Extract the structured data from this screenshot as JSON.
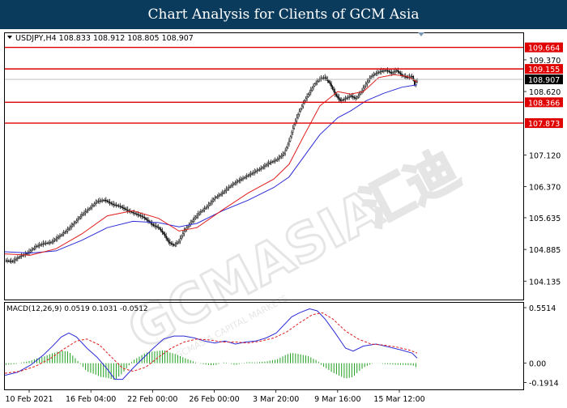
{
  "header": {
    "title": "Chart Analysis for Clients of GCM Asia"
  },
  "watermark": {
    "brand": "GCMASIA",
    "brand_cn": "汇迪",
    "tagline": "GCMASIA CAPITAL MARKETS"
  },
  "chart_data": [
    {
      "type": "candlestick",
      "symbol_line": "USDJPY,H4  108.833 108.912 108.805 108.907",
      "ylim": [
        103.7,
        110.0
      ],
      "y_ticks": [
        "109.370",
        "108.620",
        "107.120",
        "106.370",
        "105.635",
        "104.885",
        "104.135"
      ],
      "x_ticks": [
        "10 Feb 2021",
        "16 Feb 04:00",
        "22 Feb 00:00",
        "26 Feb 00:00",
        "3 Mar 20:00",
        "9 Mar 16:00",
        "15 Mar 12:00"
      ],
      "current_price": "108.907",
      "levels": [
        {
          "label": "109.664",
          "value": 109.664
        },
        {
          "label": "109.155",
          "value": 109.155
        },
        {
          "label": "108.366",
          "value": 108.366
        },
        {
          "label": "107.873",
          "value": 107.873
        }
      ],
      "close_path": [
        [
          0,
          104.62
        ],
        [
          6,
          104.6
        ],
        [
          12,
          104.72
        ],
        [
          18,
          104.8
        ],
        [
          24,
          104.95
        ],
        [
          30,
          105.02
        ],
        [
          36,
          105.05
        ],
        [
          42,
          105.18
        ],
        [
          48,
          105.32
        ],
        [
          54,
          105.5
        ],
        [
          60,
          105.7
        ],
        [
          66,
          105.85
        ],
        [
          72,
          106.02
        ],
        [
          78,
          106.05
        ],
        [
          84,
          105.95
        ],
        [
          90,
          105.9
        ],
        [
          96,
          105.8
        ],
        [
          100,
          105.75
        ],
        [
          104,
          105.7
        ],
        [
          108,
          105.65
        ],
        [
          112,
          105.55
        ],
        [
          116,
          105.45
        ],
        [
          120,
          105.4
        ],
        [
          124,
          105.25
        ],
        [
          128,
          105.05
        ],
        [
          132,
          104.98
        ],
        [
          136,
          105.08
        ],
        [
          140,
          105.32
        ],
        [
          146,
          105.55
        ],
        [
          152,
          105.75
        ],
        [
          158,
          105.9
        ],
        [
          164,
          106.1
        ],
        [
          170,
          106.22
        ],
        [
          176,
          106.38
        ],
        [
          182,
          106.5
        ],
        [
          188,
          106.6
        ],
        [
          194,
          106.7
        ],
        [
          200,
          106.8
        ],
        [
          206,
          106.92
        ],
        [
          212,
          107.0
        ],
        [
          218,
          107.15
        ],
        [
          222,
          107.45
        ],
        [
          226,
          107.85
        ],
        [
          230,
          108.15
        ],
        [
          234,
          108.4
        ],
        [
          238,
          108.6
        ],
        [
          242,
          108.8
        ],
        [
          246,
          108.92
        ],
        [
          250,
          108.95
        ],
        [
          254,
          108.8
        ],
        [
          258,
          108.55
        ],
        [
          262,
          108.4
        ],
        [
          266,
          108.45
        ],
        [
          270,
          108.52
        ],
        [
          274,
          108.45
        ],
        [
          278,
          108.6
        ],
        [
          282,
          108.8
        ],
        [
          286,
          108.98
        ],
        [
          290,
          109.05
        ],
        [
          294,
          109.1
        ],
        [
          298,
          109.12
        ],
        [
          302,
          109.05
        ],
        [
          306,
          109.12
        ],
        [
          310,
          109.0
        ],
        [
          314,
          108.95
        ],
        [
          318,
          108.98
        ],
        [
          320,
          108.78
        ],
        [
          322,
          108.9
        ]
      ],
      "fast_ma_path": [
        [
          0,
          104.78
        ],
        [
          20,
          104.75
        ],
        [
          40,
          104.9
        ],
        [
          60,
          105.25
        ],
        [
          80,
          105.68
        ],
        [
          100,
          105.8
        ],
        [
          120,
          105.62
        ],
        [
          136,
          105.32
        ],
        [
          150,
          105.4
        ],
        [
          170,
          105.82
        ],
        [
          190,
          106.22
        ],
        [
          210,
          106.55
        ],
        [
          222,
          106.9
        ],
        [
          234,
          107.6
        ],
        [
          246,
          108.28
        ],
        [
          260,
          108.62
        ],
        [
          270,
          108.56
        ],
        [
          280,
          108.62
        ],
        [
          292,
          108.95
        ],
        [
          304,
          109.02
        ],
        [
          314,
          108.98
        ],
        [
          322,
          108.85
        ]
      ],
      "slow_ma_path": [
        [
          0,
          104.83
        ],
        [
          20,
          104.8
        ],
        [
          40,
          104.85
        ],
        [
          60,
          105.1
        ],
        [
          80,
          105.4
        ],
        [
          100,
          105.55
        ],
        [
          120,
          105.52
        ],
        [
          136,
          105.42
        ],
        [
          150,
          105.5
        ],
        [
          170,
          105.8
        ],
        [
          190,
          106.05
        ],
        [
          210,
          106.35
        ],
        [
          222,
          106.6
        ],
        [
          234,
          107.1
        ],
        [
          246,
          107.6
        ],
        [
          260,
          108.0
        ],
        [
          270,
          108.16
        ],
        [
          282,
          108.4
        ],
        [
          296,
          108.58
        ],
        [
          310,
          108.72
        ],
        [
          322,
          108.78
        ]
      ]
    },
    {
      "type": "macd",
      "label": "MACD(12,26,9)  0.0519 0.1031 -0.0512",
      "ylim": [
        -0.26,
        0.6
      ],
      "y_ticks": [
        "0.5514",
        "0.00",
        "-0.1914"
      ],
      "macd_path": [
        [
          0,
          -0.12
        ],
        [
          10,
          -0.09
        ],
        [
          20,
          -0.02
        ],
        [
          30,
          0.08
        ],
        [
          38,
          0.18
        ],
        [
          44,
          0.26
        ],
        [
          50,
          0.3
        ],
        [
          56,
          0.26
        ],
        [
          64,
          0.15
        ],
        [
          72,
          0.06
        ],
        [
          80,
          -0.06
        ],
        [
          86,
          -0.16
        ],
        [
          92,
          -0.16
        ],
        [
          100,
          -0.05
        ],
        [
          108,
          0.05
        ],
        [
          116,
          0.15
        ],
        [
          124,
          0.24
        ],
        [
          132,
          0.27
        ],
        [
          140,
          0.27
        ],
        [
          148,
          0.25
        ],
        [
          156,
          0.22
        ],
        [
          164,
          0.2
        ],
        [
          172,
          0.22
        ],
        [
          180,
          0.19
        ],
        [
          188,
          0.21
        ],
        [
          196,
          0.22
        ],
        [
          204,
          0.25
        ],
        [
          212,
          0.3
        ],
        [
          218,
          0.38
        ],
        [
          224,
          0.46
        ],
        [
          230,
          0.5
        ],
        [
          238,
          0.54
        ],
        [
          244,
          0.52
        ],
        [
          250,
          0.44
        ],
        [
          258,
          0.3
        ],
        [
          266,
          0.15
        ],
        [
          272,
          0.12
        ],
        [
          280,
          0.17
        ],
        [
          290,
          0.19
        ],
        [
          300,
          0.16
        ],
        [
          310,
          0.13
        ],
        [
          318,
          0.1
        ],
        [
          322,
          0.05
        ]
      ],
      "signal_path": [
        [
          0,
          -0.1
        ],
        [
          12,
          -0.08
        ],
        [
          24,
          -0.03
        ],
        [
          36,
          0.05
        ],
        [
          46,
          0.14
        ],
        [
          56,
          0.22
        ],
        [
          64,
          0.24
        ],
        [
          74,
          0.18
        ],
        [
          84,
          0.05
        ],
        [
          92,
          -0.05
        ],
        [
          100,
          -0.08
        ],
        [
          110,
          -0.04
        ],
        [
          120,
          0.06
        ],
        [
          130,
          0.15
        ],
        [
          140,
          0.21
        ],
        [
          150,
          0.24
        ],
        [
          160,
          0.23
        ],
        [
          170,
          0.21
        ],
        [
          180,
          0.21
        ],
        [
          190,
          0.2
        ],
        [
          200,
          0.22
        ],
        [
          210,
          0.25
        ],
        [
          220,
          0.31
        ],
        [
          230,
          0.4
        ],
        [
          240,
          0.48
        ],
        [
          248,
          0.5
        ],
        [
          256,
          0.44
        ],
        [
          266,
          0.32
        ],
        [
          276,
          0.24
        ],
        [
          286,
          0.19
        ],
        [
          296,
          0.18
        ],
        [
          306,
          0.16
        ],
        [
          316,
          0.13
        ],
        [
          322,
          0.1
        ]
      ]
    }
  ]
}
